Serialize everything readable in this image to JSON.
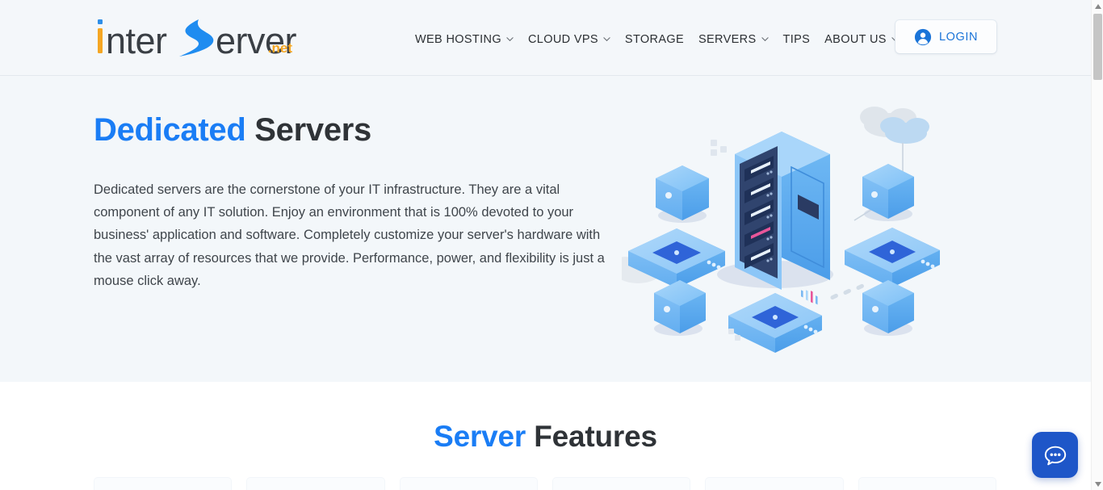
{
  "site": {
    "logo": {
      "part1": "inter",
      "part2_s": "S",
      "part3": "erver",
      "tld": ".net",
      "orange": "#f5a623",
      "blue": "#1a7df5",
      "dark": "#3a3f45"
    }
  },
  "header": {
    "nav_items": [
      {
        "label": "WEB HOSTING",
        "has_caret": true,
        "icon": "chevron-down-icon"
      },
      {
        "label": "CLOUD VPS",
        "has_caret": true,
        "icon": "chevron-down-icon"
      },
      {
        "label": "STORAGE",
        "has_caret": false,
        "icon": ""
      },
      {
        "label": "SERVERS",
        "has_caret": true,
        "icon": "chevron-down-icon"
      },
      {
        "label": "TIPS",
        "has_caret": false,
        "icon": ""
      },
      {
        "label": "ABOUT US",
        "has_caret": true,
        "icon": "chevron-down-icon"
      }
    ],
    "login": {
      "label": "LOGIN",
      "icon": "user-circle-icon",
      "accent": "#1a74d8"
    }
  },
  "hero": {
    "title_accent": "Dedicated",
    "title_rest": " Servers",
    "body": "Dedicated servers are the cornerstone of your IT infrastructure. They are a vital component of any IT solution. Enjoy an environment that is 100% devoted to your business' application and software. Completely customize your server's hardware with the vast array of resources that we provide. Performance, power, and flexibility is just a mouse click away.",
    "illustration": "isometric-server-rack-illustration",
    "background": "#f3f7fa"
  },
  "features": {
    "title_accent": "Server",
    "title_rest": " Features",
    "card_count": 6
  },
  "chat": {
    "icon": "chat-bubble-icon",
    "color": "#1e56c8"
  },
  "scrollbar": {
    "up_icon": "scroll-up-arrow-icon",
    "down_icon": "scroll-down-arrow-icon",
    "thumb": "scrollbar-thumb"
  }
}
